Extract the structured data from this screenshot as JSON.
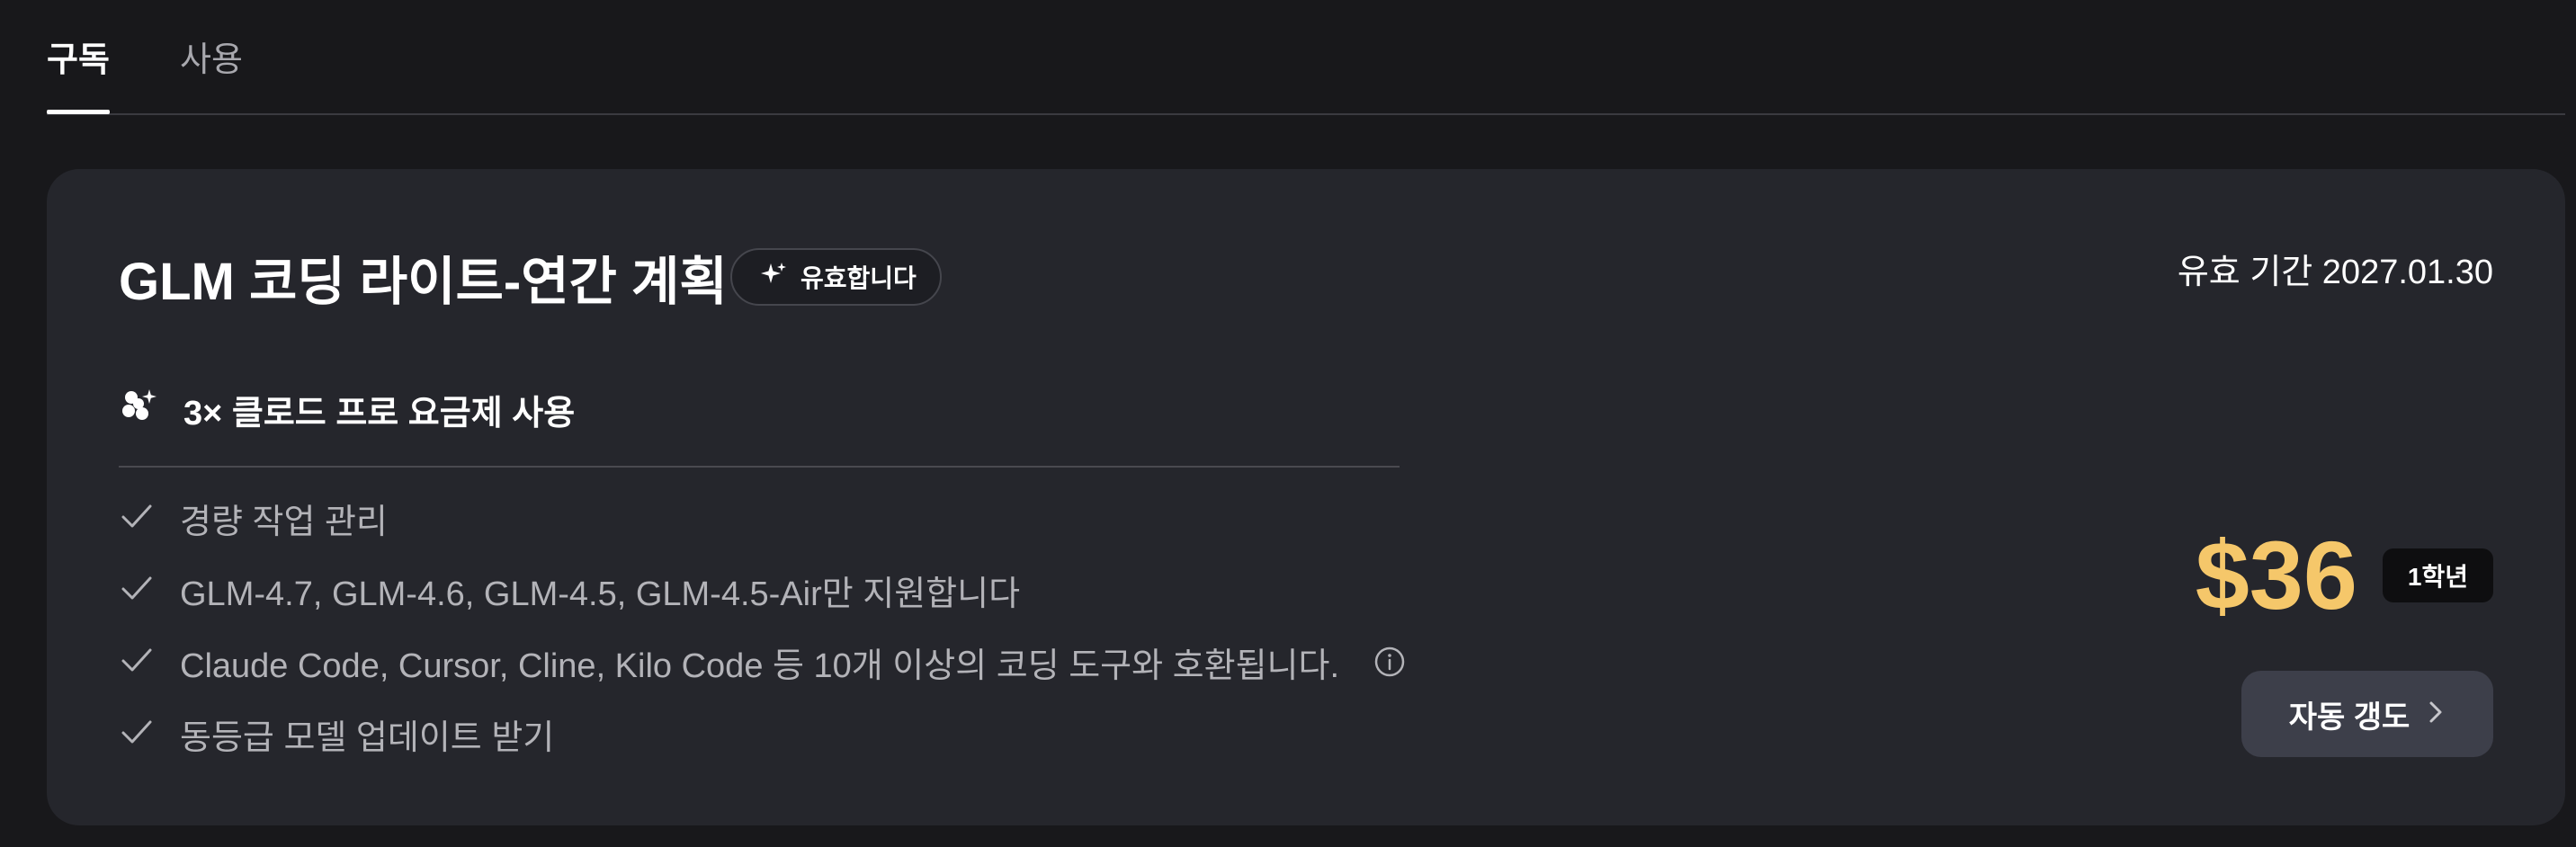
{
  "tabs": [
    {
      "label": "구독",
      "active": true
    },
    {
      "label": "사용",
      "active": false
    }
  ],
  "plan": {
    "title": "GLM 코딩 라이트-연간 계획",
    "status_badge": "유효합니다",
    "valid_until": "유효 기간 2027.01.30",
    "headline": "3× 클로드 프로 요금제 사용",
    "features": [
      "경량 작업 관리",
      "GLM-4.7, GLM-4.6, GLM-4.5, GLM-4.5-Air만 지원합니다",
      "Claude Code, Cursor, Cline, Kilo Code 등 10개 이상의 코딩 도구와 호환됩니다.",
      "동등급 모델 업데이트 받기"
    ],
    "price": "$36",
    "period": "1학년",
    "renew_label": "자동 갱도"
  },
  "colors": {
    "background": "#18181b",
    "card": "#25262c",
    "price": "#f5c76a",
    "button": "#3d3f4a"
  },
  "icons": {
    "badge": "sparkle-icon",
    "headline": "clover-sparkle-icon",
    "feature": "check-icon",
    "info": "info-icon",
    "renew": "chevron-right-icon"
  }
}
